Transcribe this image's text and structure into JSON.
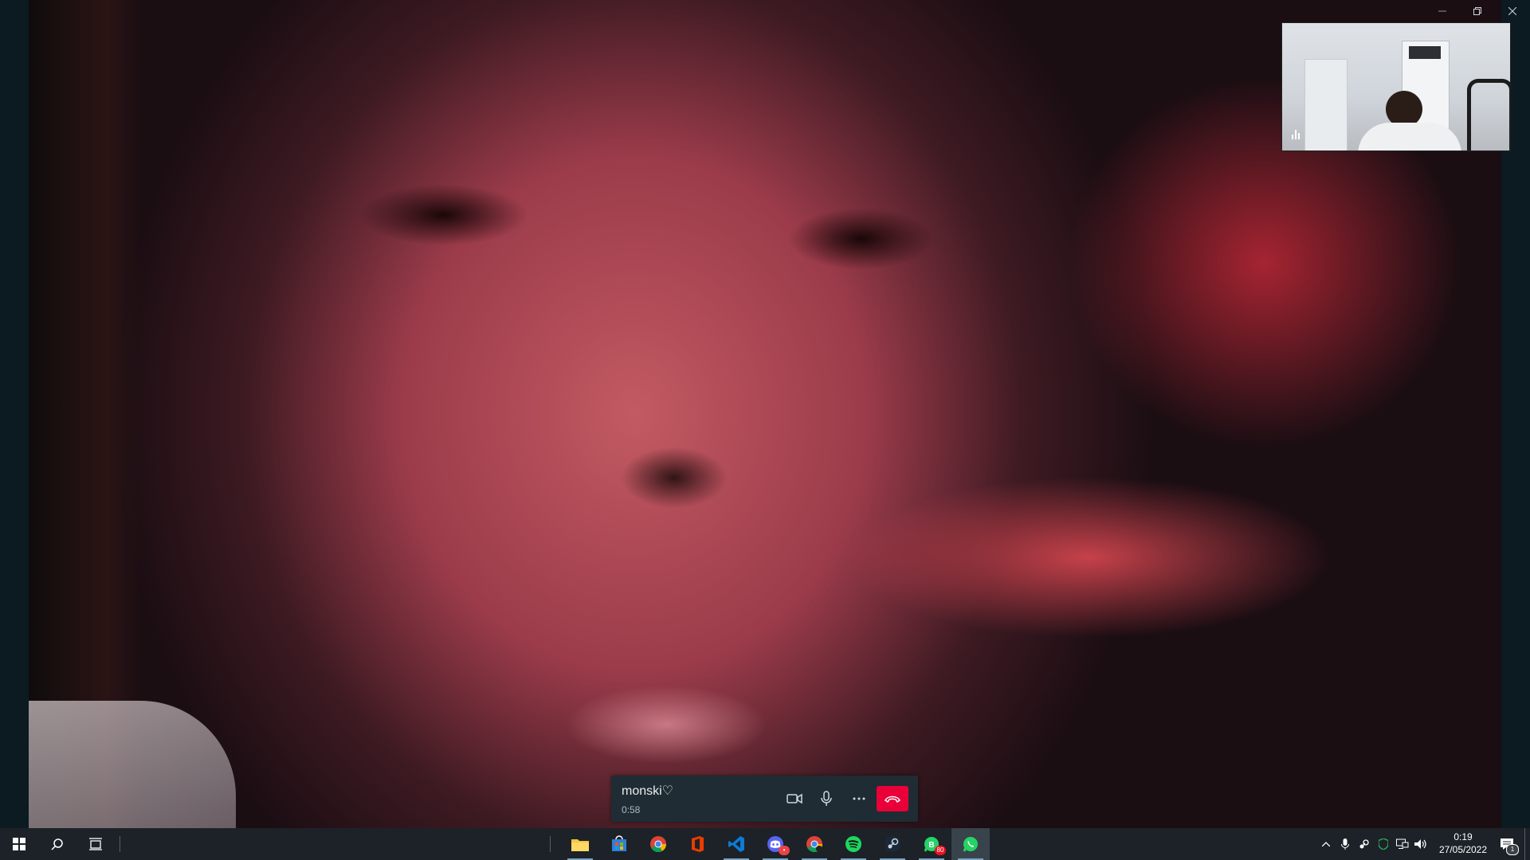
{
  "window": {
    "controls": [
      "minimize",
      "restore",
      "close"
    ]
  },
  "call": {
    "contact_name": "monski♡",
    "duration": "0:58",
    "controls": [
      "video-camera",
      "microphone",
      "more-options",
      "end-call"
    ]
  },
  "taskbar": {
    "pinned_apps": [
      "file-explorer",
      "microsoft-store",
      "chrome",
      "office",
      "vs-code",
      "discord",
      "chrome-profile",
      "spotify",
      "steam",
      "whatsapp-business",
      "whatsapp"
    ],
    "badges": {
      "whatsapp_business": "80"
    },
    "clock": {
      "time": "0:19",
      "date": "27/05/2022"
    },
    "notification_count": "1"
  },
  "colors": {
    "end_call": "#ea0038",
    "taskbar": "#1c2228",
    "call_bar": "#1f2c33"
  }
}
